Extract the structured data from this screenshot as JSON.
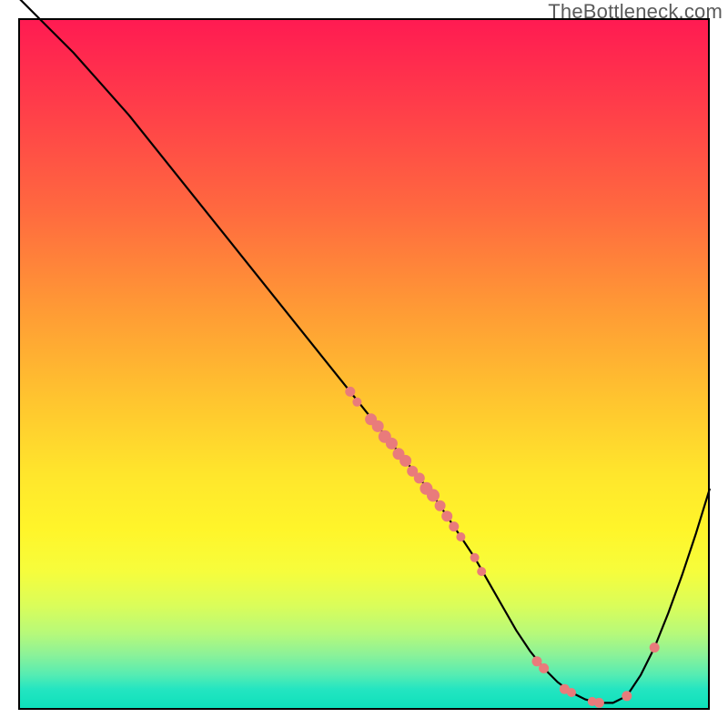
{
  "attribution": "TheBottleneck.com",
  "chart_data": {
    "type": "line",
    "title": "",
    "xlabel": "",
    "ylabel": "",
    "xlim": [
      0,
      100
    ],
    "ylim": [
      0,
      100
    ],
    "curve": {
      "x": [
        0,
        4,
        8,
        12,
        16,
        20,
        24,
        28,
        32,
        36,
        40,
        44,
        48,
        50,
        52,
        54,
        56,
        58,
        60,
        62,
        64,
        66,
        68,
        70,
        72,
        74,
        76,
        78,
        80,
        82,
        84,
        86,
        88,
        90,
        92,
        94,
        96,
        98,
        100
      ],
      "y": [
        103,
        99,
        95,
        90.5,
        86,
        81,
        76,
        71,
        66,
        61,
        56,
        51,
        46,
        43.5,
        41,
        38.5,
        36,
        33.5,
        31,
        28,
        25,
        22,
        18.5,
        15,
        11.5,
        8.5,
        6,
        4,
        2.5,
        1.5,
        1,
        1,
        2,
        5,
        9,
        14,
        19.5,
        25.5,
        32
      ]
    },
    "markers": [
      {
        "x": 48,
        "y": 46,
        "r": 5.5
      },
      {
        "x": 49,
        "y": 44.5,
        "r": 5.0
      },
      {
        "x": 51,
        "y": 42,
        "r": 6.5
      },
      {
        "x": 52,
        "y": 41,
        "r": 6.5
      },
      {
        "x": 53,
        "y": 39.5,
        "r": 7.0
      },
      {
        "x": 54,
        "y": 38.5,
        "r": 6.5
      },
      {
        "x": 55,
        "y": 37,
        "r": 6.5
      },
      {
        "x": 56,
        "y": 36,
        "r": 6.5
      },
      {
        "x": 57,
        "y": 34.5,
        "r": 6.0
      },
      {
        "x": 58,
        "y": 33.5,
        "r": 6.0
      },
      {
        "x": 59,
        "y": 32,
        "r": 7.0
      },
      {
        "x": 60,
        "y": 31,
        "r": 7.0
      },
      {
        "x": 61,
        "y": 29.5,
        "r": 6.0
      },
      {
        "x": 62,
        "y": 28,
        "r": 6.0
      },
      {
        "x": 63,
        "y": 26.5,
        "r": 5.5
      },
      {
        "x": 64,
        "y": 25,
        "r": 5.0
      },
      {
        "x": 66,
        "y": 22,
        "r": 5.0
      },
      {
        "x": 67,
        "y": 20,
        "r": 5.0
      },
      {
        "x": 75,
        "y": 7,
        "r": 5.5
      },
      {
        "x": 76,
        "y": 6,
        "r": 5.5
      },
      {
        "x": 79,
        "y": 3,
        "r": 5.5
      },
      {
        "x": 80,
        "y": 2.5,
        "r": 5.0
      },
      {
        "x": 83,
        "y": 1.2,
        "r": 5.0
      },
      {
        "x": 84,
        "y": 1,
        "r": 5.5
      },
      {
        "x": 88,
        "y": 2,
        "r": 5.5
      },
      {
        "x": 92,
        "y": 9,
        "r": 5.5
      }
    ],
    "colors": {
      "curve": "#000000",
      "marker": "#e97b7b"
    }
  }
}
